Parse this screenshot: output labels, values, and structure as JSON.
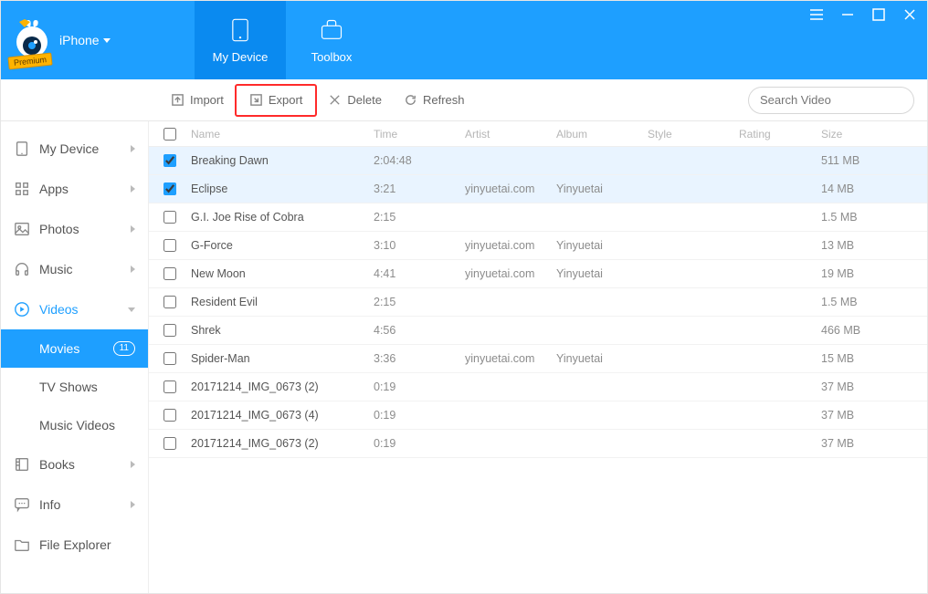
{
  "header": {
    "device_label": "iPhone",
    "premium_label": "Premium",
    "tabs": [
      {
        "label": "My Device",
        "active": true
      },
      {
        "label": "Toolbox",
        "active": false
      }
    ]
  },
  "actions": {
    "import": "Import",
    "export": "Export",
    "delete": "Delete",
    "refresh": "Refresh"
  },
  "search": {
    "placeholder": "Search Video"
  },
  "sidebar": {
    "items": [
      {
        "label": "My Device",
        "expandable": true
      },
      {
        "label": "Apps",
        "expandable": true
      },
      {
        "label": "Photos",
        "expandable": true
      },
      {
        "label": "Music",
        "expandable": true
      },
      {
        "label": "Videos",
        "expandable": true,
        "active": true
      },
      {
        "label": "Books",
        "expandable": true
      },
      {
        "label": "Info",
        "expandable": true
      },
      {
        "label": "File Explorer",
        "expandable": false
      }
    ],
    "video_subs": [
      {
        "label": "Movies",
        "badge": "11",
        "active": true
      },
      {
        "label": "TV Shows"
      },
      {
        "label": "Music Videos"
      }
    ]
  },
  "columns": {
    "name": "Name",
    "time": "Time",
    "artist": "Artist",
    "album": "Album",
    "style": "Style",
    "rating": "Rating",
    "size": "Size"
  },
  "rows": [
    {
      "selected": true,
      "name": "Breaking Dawn",
      "time": "2:04:48",
      "artist": "",
      "album": "",
      "size": "511 MB"
    },
    {
      "selected": true,
      "name": "Eclipse",
      "time": "3:21",
      "artist": "yinyuetai.com",
      "album": "Yinyuetai",
      "size": "14 MB"
    },
    {
      "selected": false,
      "name": "G.I. Joe Rise of Cobra",
      "time": "2:15",
      "artist": "",
      "album": "",
      "size": "1.5 MB"
    },
    {
      "selected": false,
      "name": "G-Force",
      "time": "3:10",
      "artist": "yinyuetai.com",
      "album": "Yinyuetai",
      "size": "13 MB"
    },
    {
      "selected": false,
      "name": "New Moon",
      "time": "4:41",
      "artist": "yinyuetai.com",
      "album": "Yinyuetai",
      "size": "19 MB"
    },
    {
      "selected": false,
      "name": "Resident Evil",
      "time": "2:15",
      "artist": "",
      "album": "",
      "size": "1.5 MB"
    },
    {
      "selected": false,
      "name": "Shrek",
      "time": "4:56",
      "artist": "",
      "album": "",
      "size": "466 MB"
    },
    {
      "selected": false,
      "name": "Spider-Man",
      "time": "3:36",
      "artist": "yinyuetai.com",
      "album": "Yinyuetai",
      "size": "15 MB"
    },
    {
      "selected": false,
      "name": "20171214_IMG_0673 (2)",
      "time": "0:19",
      "artist": "",
      "album": "",
      "size": "37 MB"
    },
    {
      "selected": false,
      "name": "20171214_IMG_0673 (4)",
      "time": "0:19",
      "artist": "",
      "album": "",
      "size": "37 MB"
    },
    {
      "selected": false,
      "name": "20171214_IMG_0673 (2)",
      "time": "0:19",
      "artist": "",
      "album": "",
      "size": "37 MB"
    }
  ]
}
